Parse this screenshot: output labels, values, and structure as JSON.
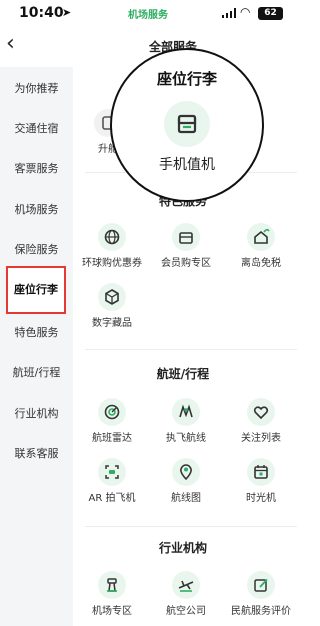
{
  "status_bar": {
    "time": "10:40",
    "location_glyph": "➤",
    "app_name": "机场服务",
    "wifi_glyph": "◠",
    "battery": "62"
  },
  "nav": {
    "back_glyph": "‹"
  },
  "sidebar": {
    "items": [
      {
        "label": "为你推荐"
      },
      {
        "label": "交通住宿"
      },
      {
        "label": "客票服务"
      },
      {
        "label": "机场服务"
      },
      {
        "label": "保险服务"
      },
      {
        "label": "座位行李"
      },
      {
        "label": "特色服务"
      },
      {
        "label": "航班/行程"
      },
      {
        "label": "行业机构"
      },
      {
        "label": "联系客服"
      }
    ],
    "active_index": 5
  },
  "main": {
    "header": "全部服务",
    "partial_label": "升舱",
    "magnifier": {
      "section_title": "座位行李",
      "item_label": "手机值机",
      "item_icon": "seat-icon"
    },
    "sections": [
      {
        "title": "特色服务",
        "items": [
          {
            "label": "环球购优惠券",
            "icon": "globe-icon"
          },
          {
            "label": "会员购专区",
            "icon": "shopping-icon"
          },
          {
            "label": "离岛免税",
            "icon": "island-icon"
          },
          {
            "label": "数字藏品",
            "icon": "cube-icon"
          }
        ]
      },
      {
        "title": "航班/行程",
        "items": [
          {
            "label": "航班雷达",
            "icon": "radar-icon"
          },
          {
            "label": "执飞航线",
            "icon": "route-icon"
          },
          {
            "label": "关注列表",
            "icon": "heart-icon"
          },
          {
            "label": "AR 拍飞机",
            "icon": "ar-icon"
          },
          {
            "label": "航线图",
            "icon": "map-pin-icon"
          },
          {
            "label": "时光机",
            "icon": "calendar-icon"
          }
        ]
      },
      {
        "title": "行业机构",
        "items": [
          {
            "label": "机场专区",
            "icon": "tower-icon"
          },
          {
            "label": "航空公司",
            "icon": "plane-icon"
          },
          {
            "label": "民航服务评价",
            "icon": "edit-icon"
          }
        ]
      }
    ]
  },
  "colors": {
    "accent_green": "#2fae62",
    "icon_bg": "#e9f6ee",
    "active_outline": "#e53935",
    "sidebar_bg": "#f4f5f6"
  }
}
